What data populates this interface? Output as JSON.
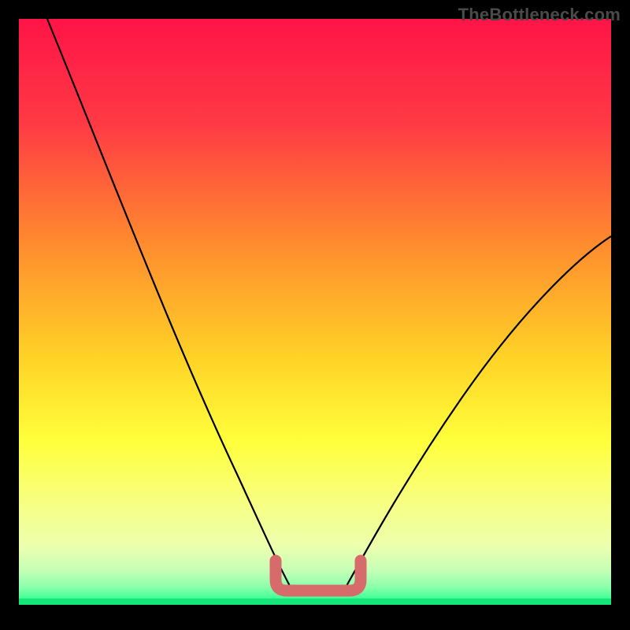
{
  "watermark": "TheBottleneck.com",
  "colors": {
    "black": "#000000",
    "gradient_top": "#ff1447",
    "gradient_mid1": "#ff6a2e",
    "gradient_mid2": "#ffe63a",
    "gradient_low1": "#f8ff8c",
    "gradient_low2": "#d6ffb0",
    "gradient_bottom": "#18ff88",
    "curve": "#000000",
    "bracket": "#d76a6a"
  },
  "chart_data": {
    "type": "line",
    "title": "",
    "xlabel": "",
    "ylabel": "",
    "xlim": [
      0,
      100
    ],
    "ylim": [
      0,
      100
    ],
    "grid": false,
    "series": [
      {
        "name": "left-curve",
        "x": [
          5,
          10,
          15,
          20,
          25,
          30,
          35,
          40,
          42.5,
          45
        ],
        "values": [
          100,
          86,
          73,
          61,
          50,
          40,
          30,
          18,
          11,
          5
        ]
      },
      {
        "name": "right-curve",
        "x": [
          55,
          57.5,
          60,
          65,
          70,
          75,
          80,
          85,
          90,
          95,
          100
        ],
        "values": [
          5,
          10,
          15,
          23,
          30,
          36,
          41,
          46,
          50,
          54,
          58
        ]
      }
    ],
    "annotations": [
      {
        "name": "bracket",
        "type": "bracket",
        "x_start": 43,
        "x_end": 56,
        "y": 4,
        "color": "#d76a6a"
      },
      {
        "name": "bottom-green-band",
        "type": "band",
        "y_start": 0,
        "y_end": 3
      }
    ]
  }
}
